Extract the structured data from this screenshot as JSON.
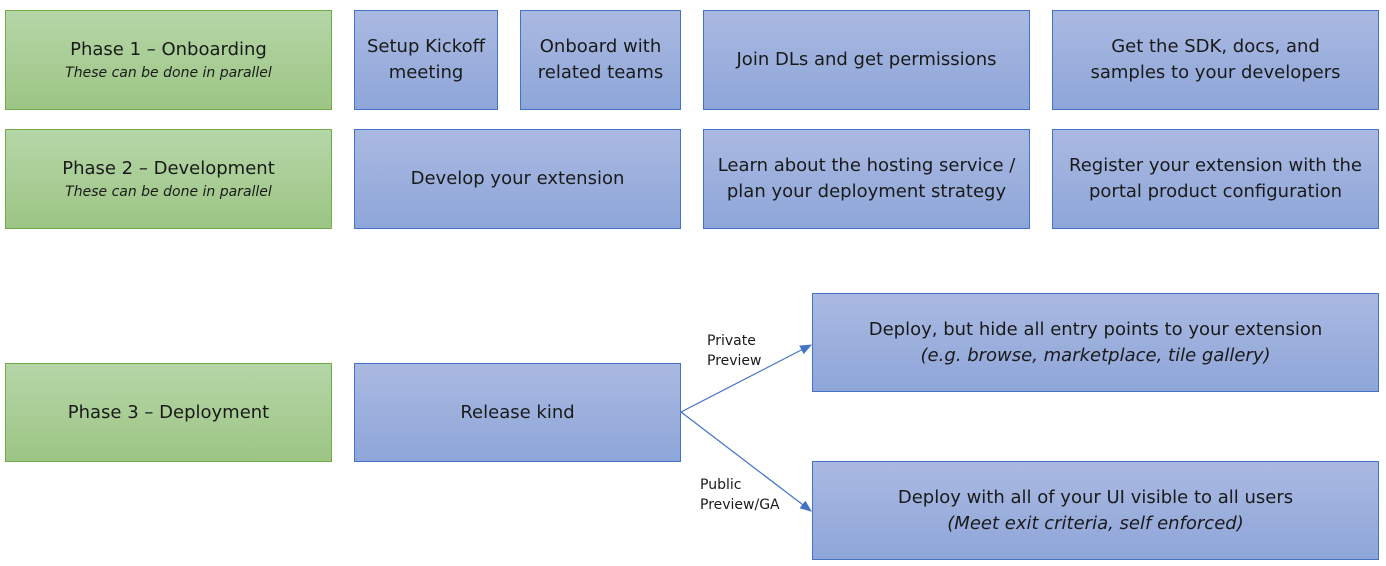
{
  "phases": [
    {
      "title": "Phase 1 – Onboarding",
      "note": "These can be done in parallel",
      "tasks": [
        "Setup Kickoff meeting",
        "Onboard with related teams",
        "Join DLs and get permissions",
        "Get the SDK, docs, and samples to your developers"
      ]
    },
    {
      "title": "Phase 2 – Development",
      "note": "These can be done in parallel",
      "tasks": [
        "Develop your extension",
        "Learn about the hosting service / plan your deployment strategy",
        "Register your extension with the portal product configuration"
      ]
    },
    {
      "title": "Phase 3 – Deployment",
      "tasks": [
        "Release kind"
      ]
    }
  ],
  "branches": [
    {
      "label": "Private Preview",
      "title": "Deploy, but hide all entry points to your extension",
      "note": "(e.g. browse, marketplace, tile gallery)"
    },
    {
      "label": "Public Preview/GA",
      "title": "Deploy with all of your UI visible to all users",
      "note": "(Meet exit criteria, self enforced)"
    }
  ]
}
